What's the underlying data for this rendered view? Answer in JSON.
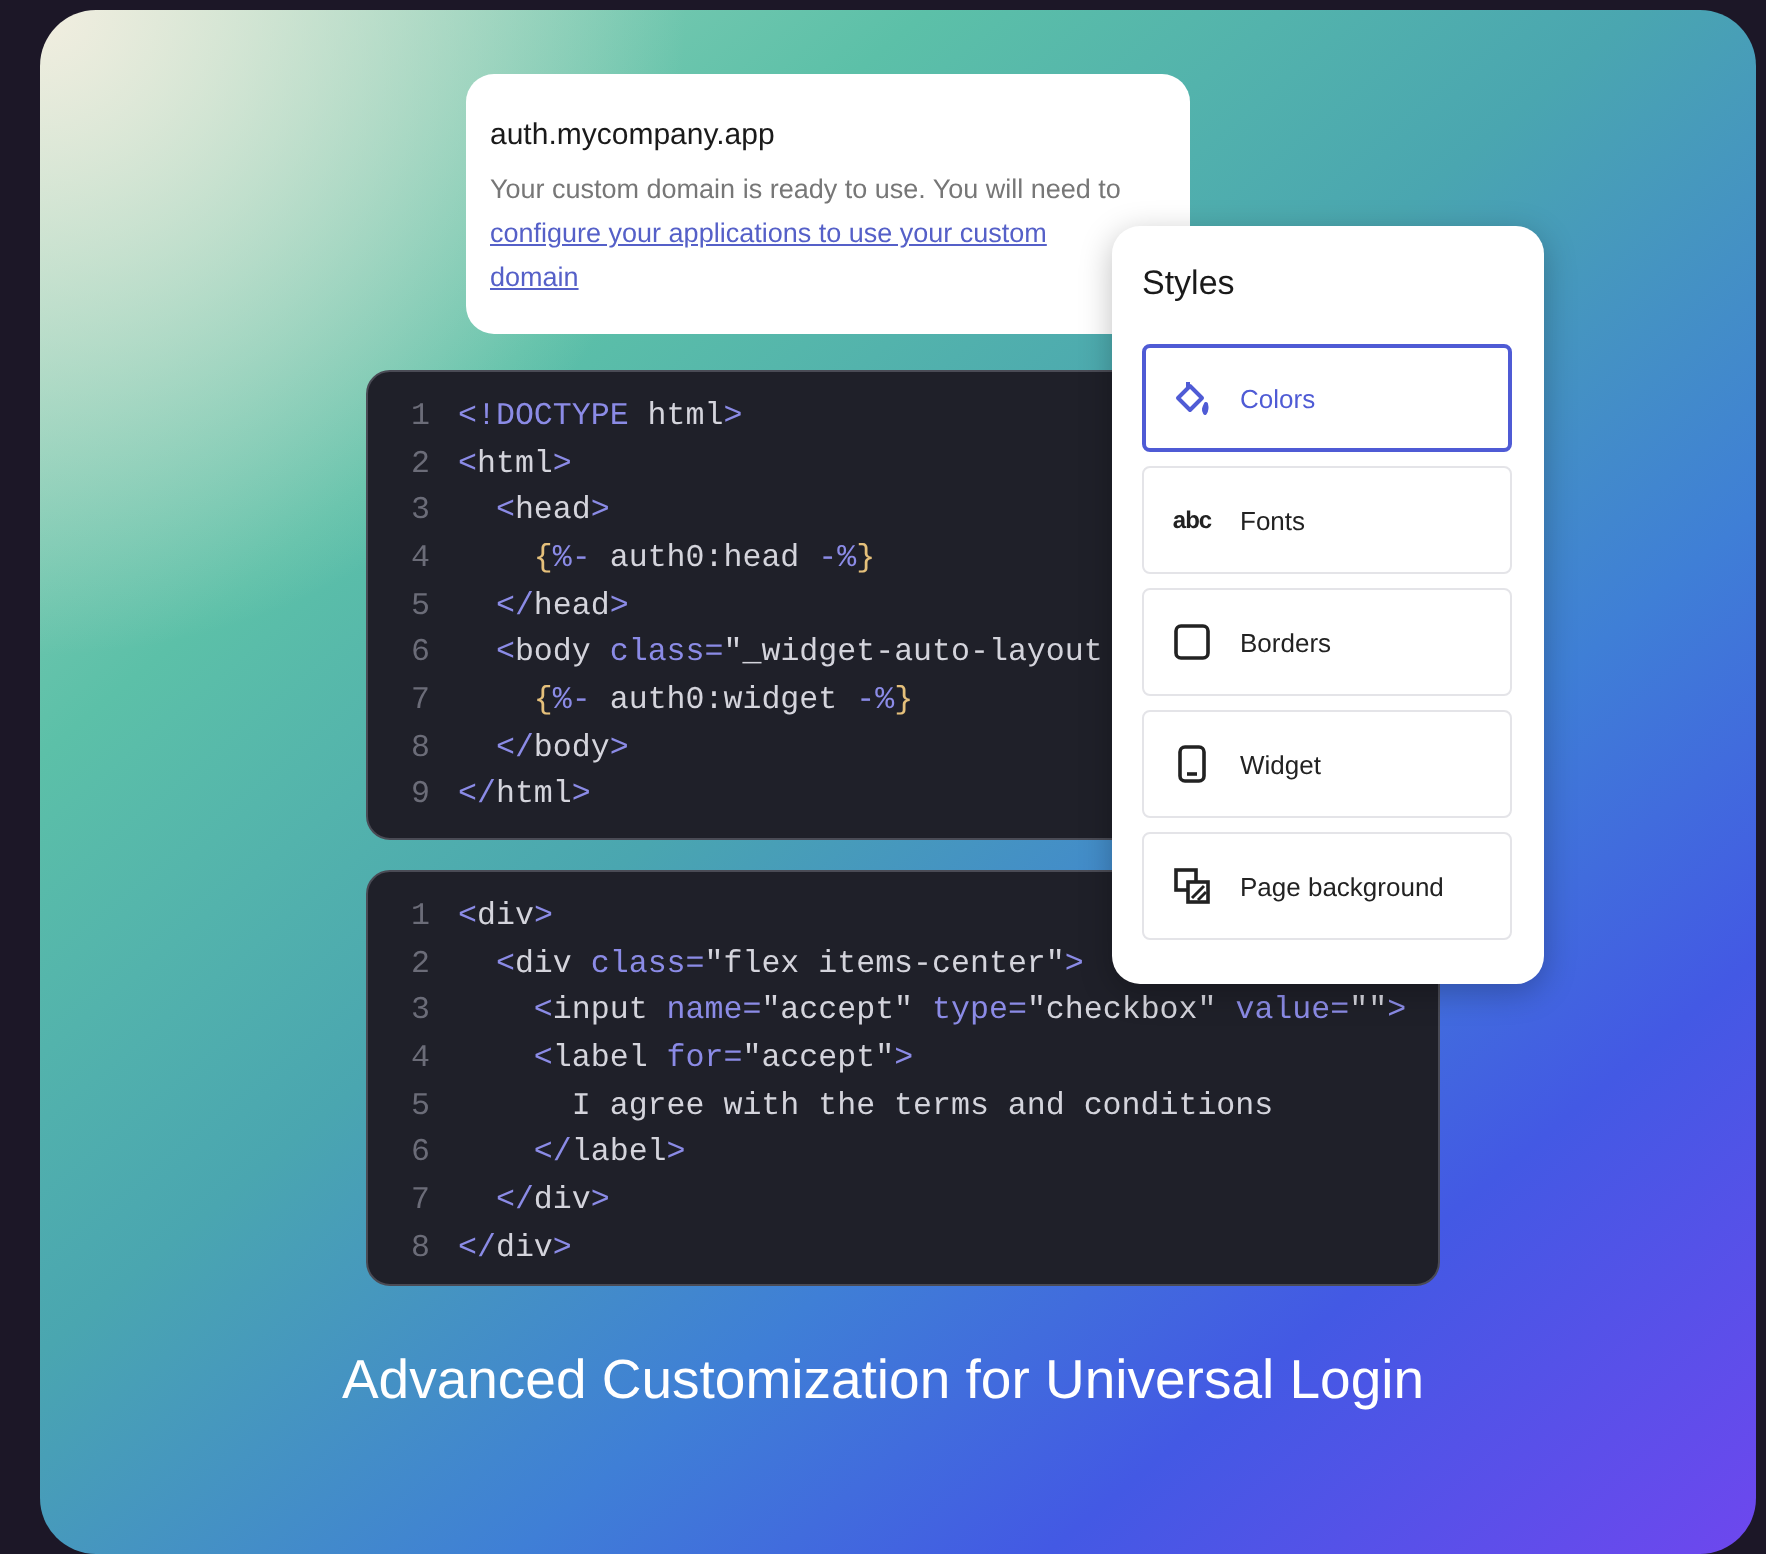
{
  "domain_card": {
    "title": "auth.mycompany.app",
    "message": "Your custom domain is ready to use. You will need to",
    "link": "configure your applications to use your custom domain"
  },
  "code_blocks": [
    {
      "lines": [
        {
          "number": "1",
          "tokens": [
            {
              "kind": "punct",
              "text": "<!DOCTYPE"
            },
            {
              "kind": "plain",
              "text": " html"
            },
            {
              "kind": "punct",
              "text": ">"
            }
          ]
        },
        {
          "number": "2",
          "tokens": [
            {
              "kind": "punct",
              "text": "<"
            },
            {
              "kind": "plain",
              "text": "html"
            },
            {
              "kind": "punct",
              "text": ">"
            }
          ]
        },
        {
          "number": "3",
          "tokens": [
            {
              "kind": "punct",
              "text": "  <"
            },
            {
              "kind": "plain",
              "text": "head"
            },
            {
              "kind": "punct",
              "text": ">"
            }
          ]
        },
        {
          "number": "4",
          "tokens": [
            {
              "kind": "brace",
              "text": "    {"
            },
            {
              "kind": "punct",
              "text": "%-"
            },
            {
              "kind": "plain",
              "text": " auth0:head "
            },
            {
              "kind": "punct",
              "text": "-%"
            },
            {
              "kind": "brace",
              "text": "}"
            }
          ]
        },
        {
          "number": "5",
          "tokens": [
            {
              "kind": "punct",
              "text": "  </"
            },
            {
              "kind": "plain",
              "text": "head"
            },
            {
              "kind": "punct",
              "text": ">"
            }
          ]
        },
        {
          "number": "6",
          "tokens": [
            {
              "kind": "punct",
              "text": "  <"
            },
            {
              "kind": "plain",
              "text": "body "
            },
            {
              "kind": "punct",
              "text": "class="
            },
            {
              "kind": "plain",
              "text": "\"_widget-auto-layout"
            }
          ]
        },
        {
          "number": "7",
          "tokens": [
            {
              "kind": "brace",
              "text": "    {"
            },
            {
              "kind": "punct",
              "text": "%-"
            },
            {
              "kind": "plain",
              "text": " auth0:widget "
            },
            {
              "kind": "punct",
              "text": "-%"
            },
            {
              "kind": "brace",
              "text": "}"
            }
          ]
        },
        {
          "number": "8",
          "tokens": [
            {
              "kind": "punct",
              "text": "  </"
            },
            {
              "kind": "plain",
              "text": "body"
            },
            {
              "kind": "punct",
              "text": ">"
            }
          ]
        },
        {
          "number": "9",
          "tokens": [
            {
              "kind": "punct",
              "text": "</"
            },
            {
              "kind": "plain",
              "text": "html"
            },
            {
              "kind": "punct",
              "text": ">"
            }
          ]
        }
      ]
    },
    {
      "lines": [
        {
          "number": "1",
          "tokens": [
            {
              "kind": "punct",
              "text": "<"
            },
            {
              "kind": "plain",
              "text": "div"
            },
            {
              "kind": "punct",
              "text": ">"
            }
          ]
        },
        {
          "number": "2",
          "tokens": [
            {
              "kind": "punct",
              "text": "  <"
            },
            {
              "kind": "plain",
              "text": "div "
            },
            {
              "kind": "punct",
              "text": "class="
            },
            {
              "kind": "plain",
              "text": "\"flex items-center\""
            },
            {
              "kind": "punct",
              "text": ">"
            }
          ]
        },
        {
          "number": "3",
          "tokens": [
            {
              "kind": "punct",
              "text": "    <"
            },
            {
              "kind": "plain",
              "text": "input "
            },
            {
              "kind": "punct",
              "text": "name="
            },
            {
              "kind": "plain",
              "text": "\"accept\" "
            },
            {
              "kind": "punct",
              "text": "type="
            },
            {
              "kind": "plain",
              "text": "\"checkbox\" "
            },
            {
              "kind": "punct",
              "text": "value="
            },
            {
              "kind": "plain",
              "text": "\"\""
            },
            {
              "kind": "punct",
              "text": ">"
            }
          ]
        },
        {
          "number": "4",
          "tokens": [
            {
              "kind": "punct",
              "text": "    <"
            },
            {
              "kind": "plain",
              "text": "label "
            },
            {
              "kind": "punct",
              "text": "for="
            },
            {
              "kind": "plain",
              "text": "\"accept\""
            },
            {
              "kind": "punct",
              "text": ">"
            }
          ]
        },
        {
          "number": "5",
          "tokens": [
            {
              "kind": "plain",
              "text": "      I agree with the terms and conditions"
            }
          ]
        },
        {
          "number": "6",
          "tokens": [
            {
              "kind": "punct",
              "text": "    </"
            },
            {
              "kind": "plain",
              "text": "label"
            },
            {
              "kind": "punct",
              "text": ">"
            }
          ]
        },
        {
          "number": "7",
          "tokens": [
            {
              "kind": "punct",
              "text": "  </"
            },
            {
              "kind": "plain",
              "text": "div"
            },
            {
              "kind": "punct",
              "text": ">"
            }
          ]
        },
        {
          "number": "8",
          "tokens": [
            {
              "kind": "punct",
              "text": "</"
            },
            {
              "kind": "plain",
              "text": "div"
            },
            {
              "kind": "punct",
              "text": ">"
            }
          ]
        }
      ]
    }
  ],
  "styles_panel": {
    "title": "Styles",
    "items": [
      {
        "label": "Colors",
        "kind": "bucket",
        "selected": true
      },
      {
        "label": "Fonts",
        "kind": "text",
        "icon_text": "abc",
        "selected": false
      },
      {
        "label": "Borders",
        "kind": "square",
        "selected": false
      },
      {
        "label": "Widget",
        "kind": "phone",
        "selected": false
      },
      {
        "label": "Page background",
        "kind": "layers",
        "selected": false
      }
    ]
  },
  "caption": "Advanced Customization for Universal Login"
}
